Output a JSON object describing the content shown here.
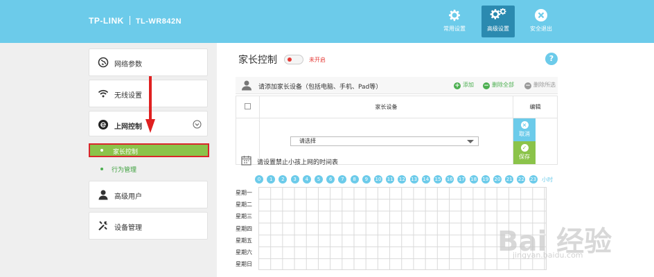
{
  "header": {
    "brand": "TP-LINK",
    "model": "TL-WR842N",
    "buttons": [
      {
        "label": "常用设置",
        "icon": "gear-icon"
      },
      {
        "label": "高级设置",
        "icon": "gears-icon"
      },
      {
        "label": "安全退出",
        "icon": "close-circle-icon"
      }
    ]
  },
  "sidebar": {
    "items": [
      {
        "label": "网络参数",
        "icon": "globe-icon"
      },
      {
        "label": "无线设置",
        "icon": "wifi-icon"
      },
      {
        "label": "上网控制",
        "icon": "internet-e-icon"
      },
      {
        "label": "高级用户",
        "icon": "user-icon"
      },
      {
        "label": "设备管理",
        "icon": "tools-icon"
      }
    ],
    "sub_items": [
      {
        "label": "家长控制"
      },
      {
        "label": "行为管理"
      }
    ]
  },
  "main": {
    "title": "家长控制",
    "toggle_status": "未开启",
    "help": "?",
    "devices_section": {
      "title": "请添加家长设备（包括电脑、手机、Pad等）",
      "add": "添加",
      "delete_all": "删除全部",
      "delete_selected": "删除所选",
      "col_device": "家长设备",
      "col_edit": "编辑",
      "select_placeholder": "请选择",
      "cancel": "取消",
      "save": "保存"
    },
    "schedule": {
      "title": "请设置禁止小孩上网的时间表",
      "hours": [
        "0",
        "1",
        "2",
        "3",
        "4",
        "5",
        "6",
        "7",
        "8",
        "9",
        "10",
        "11",
        "12",
        "13",
        "14",
        "15",
        "16",
        "17",
        "18",
        "19",
        "20",
        "21",
        "22",
        "23"
      ],
      "hour_unit": "小时",
      "days": [
        "星期一",
        "星期二",
        "星期三",
        "星期四",
        "星期五",
        "星期六",
        "星期日"
      ]
    }
  },
  "watermark": {
    "text": "Bai 经验",
    "url": "jingyan.baidu.com"
  },
  "colors": {
    "header": "#6ccbea",
    "active_btn": "#2b8ab0",
    "green": "#8bc34a",
    "red": "#d9252b"
  }
}
